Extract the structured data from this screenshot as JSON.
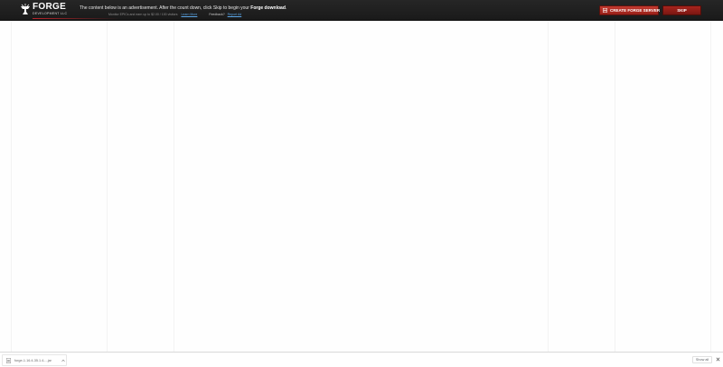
{
  "topbar": {
    "logo": {
      "title": "FORGE",
      "subtitle": "DEVELOPMENT LLC",
      "icon": "anvil-icon"
    },
    "ad_message": {
      "prefix": "The content below is an advertisement. After the count down, click Skip to begin your ",
      "bold": "Forge download",
      "suffix": "."
    },
    "sub_message": {
      "text": "Monitor EPICs and earn up to $2.00 / 100 visitors",
      "link": "Learn More",
      "feedback": "Feedback?",
      "report": "Report Ad"
    },
    "create_server_button": {
      "label": "CREATE FORGE SERVER",
      "icon": "server-icon"
    },
    "skip_button": {
      "label": "SKIP"
    },
    "colors": {
      "bar_background": "#1f1f1f",
      "accent_red": "#b8242a",
      "button_red": "#a8241d"
    }
  },
  "download_shelf": {
    "item": {
      "filename": "forge-1.16.4-35.1.4-...jar",
      "icon": "jar-file-icon"
    },
    "show_all_label": "Show all",
    "close_icon": "close-icon"
  }
}
